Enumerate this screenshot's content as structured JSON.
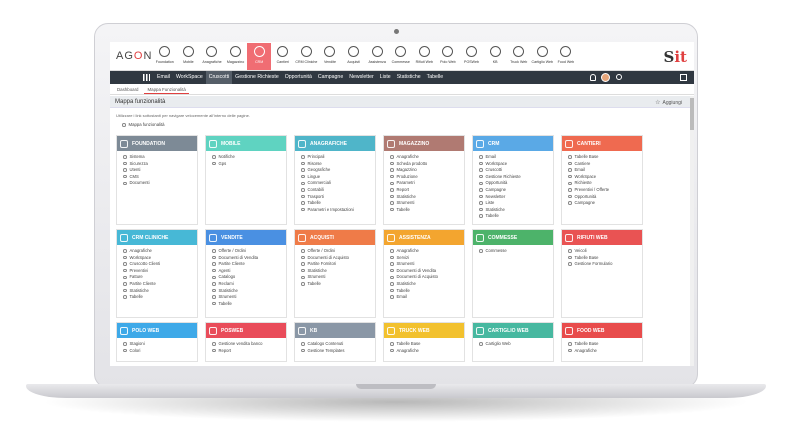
{
  "app": {
    "logo_a": "AG",
    "logo_o": "O",
    "logo_b": "N",
    "brand_s": "S",
    "brand_it": "it"
  },
  "modules": [
    {
      "label": "Foundation",
      "icon": "gear-icon"
    },
    {
      "label": "Mobile",
      "icon": "mobile-icon"
    },
    {
      "label": "Anagrafiche",
      "icon": "people-icon"
    },
    {
      "label": "Magazzino",
      "icon": "box-icon"
    },
    {
      "label": "CRM",
      "icon": "handshake-icon",
      "active": true
    },
    {
      "label": "Cantieri",
      "icon": "crane-icon"
    },
    {
      "label": "CRM Cliniche",
      "icon": "clinic-icon"
    },
    {
      "label": "Vendite",
      "icon": "cart-icon"
    },
    {
      "label": "Acquisti",
      "icon": "bag-icon"
    },
    {
      "label": "Assistenza",
      "icon": "headset-icon"
    },
    {
      "label": "Commesse",
      "icon": "folder-icon"
    },
    {
      "label": "Rifiuti Web",
      "icon": "recycle-icon"
    },
    {
      "label": "Polo Web",
      "icon": "polo-icon"
    },
    {
      "label": "POSWeb",
      "icon": "pos-icon"
    },
    {
      "label": "KB",
      "icon": "book-icon"
    },
    {
      "label": "Truck Web",
      "icon": "truck-icon"
    },
    {
      "label": "Cartiglio Web",
      "icon": "doc-icon"
    },
    {
      "label": "Food Web",
      "icon": "food-icon"
    }
  ],
  "nav": [
    "Email",
    "WorkSpace",
    "Cruscotti",
    "Gestione Richieste",
    "Opportunità",
    "Campagne",
    "Newsletter",
    "Liste",
    "Statistiche",
    "Tabelle"
  ],
  "nav_active": "Cruscotti",
  "tabs": [
    "Dashboard",
    "Mappa Funzionalità"
  ],
  "page": {
    "title": "Mappa funzionalità",
    "add_label": "Aggiungi",
    "description": "Utilizzare i link sottostanti per navigare velocemente all'interno delle pagine.",
    "map_link": "Mappa funzionalità"
  },
  "colors": {
    "navbar": "#303841",
    "accent": "#f06d73"
  },
  "cards": [
    {
      "title": "FOUNDATION",
      "color": "#7d8a96",
      "items": [
        "Sistema",
        "Sicurezza",
        "Utenti",
        "CMS",
        "Documenti"
      ]
    },
    {
      "title": "MOBILE",
      "color": "#5fd3c1",
      "items": [
        "Notifiche",
        "Gps"
      ]
    },
    {
      "title": "ANAGRAFICHE",
      "color": "#4fb5c9",
      "items": [
        "Principali",
        "Risorse",
        "Geografiche",
        "Lingue",
        "Commerciali",
        "Contabili",
        "Trasporti",
        "Tabelle",
        "Parametri e Impostazioni"
      ]
    },
    {
      "title": "MAGAZZINO",
      "color": "#b07a72",
      "items": [
        "Anagrafiche",
        "Scheda prodotto",
        "Magazzino",
        "Produzione",
        "Parametri",
        "Report",
        "Statistiche",
        "Strumenti",
        "Tabelle"
      ]
    },
    {
      "title": "CRM",
      "color": "#5aa9e6",
      "items": [
        "Email",
        "WorkSpace",
        "Cruscotti",
        "Gestione Richieste",
        "Opportunità",
        "Campagne",
        "Newsletter",
        "Liste",
        "Statistiche",
        "Tabelle"
      ]
    },
    {
      "title": "CANTIERI",
      "color": "#ef6a50",
      "items": [
        "Tabelle Base",
        "Cantiere",
        "Email",
        "WorkSpace",
        "Richieste",
        "Preventivi / Offerte",
        "Opportunità",
        "Campagne"
      ]
    },
    {
      "title": "CRM CLINICHE",
      "color": "#47b8d6",
      "items": [
        "Anagrafiche",
        "WorkSpace",
        "Cruscotto Clienti",
        "Preventivi",
        "Fatture",
        "Partite Cliente",
        "Statistiche",
        "Tabelle"
      ]
    },
    {
      "title": "VENDITE",
      "color": "#4a90e2",
      "items": [
        "Offerte / Ordini",
        "Documenti di Vendita",
        "Partite Cliente",
        "Agenti",
        "Catalogo",
        "Reclami",
        "Statistiche",
        "Strumenti",
        "Tabelle"
      ]
    },
    {
      "title": "ACQUISTI",
      "color": "#ef7b48",
      "items": [
        "Offerte / Ordini",
        "Documenti di Acquisto",
        "Partite Fornitori",
        "Statistiche",
        "Strumenti",
        "Tabelle"
      ]
    },
    {
      "title": "ASSISTENZA",
      "color": "#f3a52f",
      "items": [
        "Anagrafiche",
        "Servizi",
        "Strumenti",
        "Documenti di Vendita",
        "Documenti di Acquisto",
        "Statistiche",
        "Tabelle",
        "Email"
      ]
    },
    {
      "title": "COMMESSE",
      "color": "#4db36a",
      "items": [
        "Commesse"
      ]
    },
    {
      "title": "RIFIUTI WEB",
      "color": "#e95353",
      "items": [
        "Veicoli",
        "Tabelle Base",
        "Gestione Formulario"
      ]
    },
    {
      "title": "POLO WEB",
      "color": "#3ea9e8",
      "items": [
        "Stagioni",
        "Colori"
      ]
    },
    {
      "title": "POSWEB",
      "color": "#e94c5a",
      "items": [
        "Gestione vendita banco",
        "Report"
      ]
    },
    {
      "title": "KB",
      "color": "#8a97a6",
      "items": [
        "Catalogo Contenuti",
        "Gestione Templates"
      ]
    },
    {
      "title": "TRUCK WEB",
      "color": "#f2c12e",
      "items": [
        "Tabelle Base",
        "Anagrafiche"
      ]
    },
    {
      "title": "CARTIGLIO WEB",
      "color": "#47b8a0",
      "items": [
        "Cartiglio Web"
      ]
    },
    {
      "title": "FOOD WEB",
      "color": "#e84c4c",
      "items": [
        "Tabelle Base",
        "Anagrafiche"
      ]
    }
  ]
}
